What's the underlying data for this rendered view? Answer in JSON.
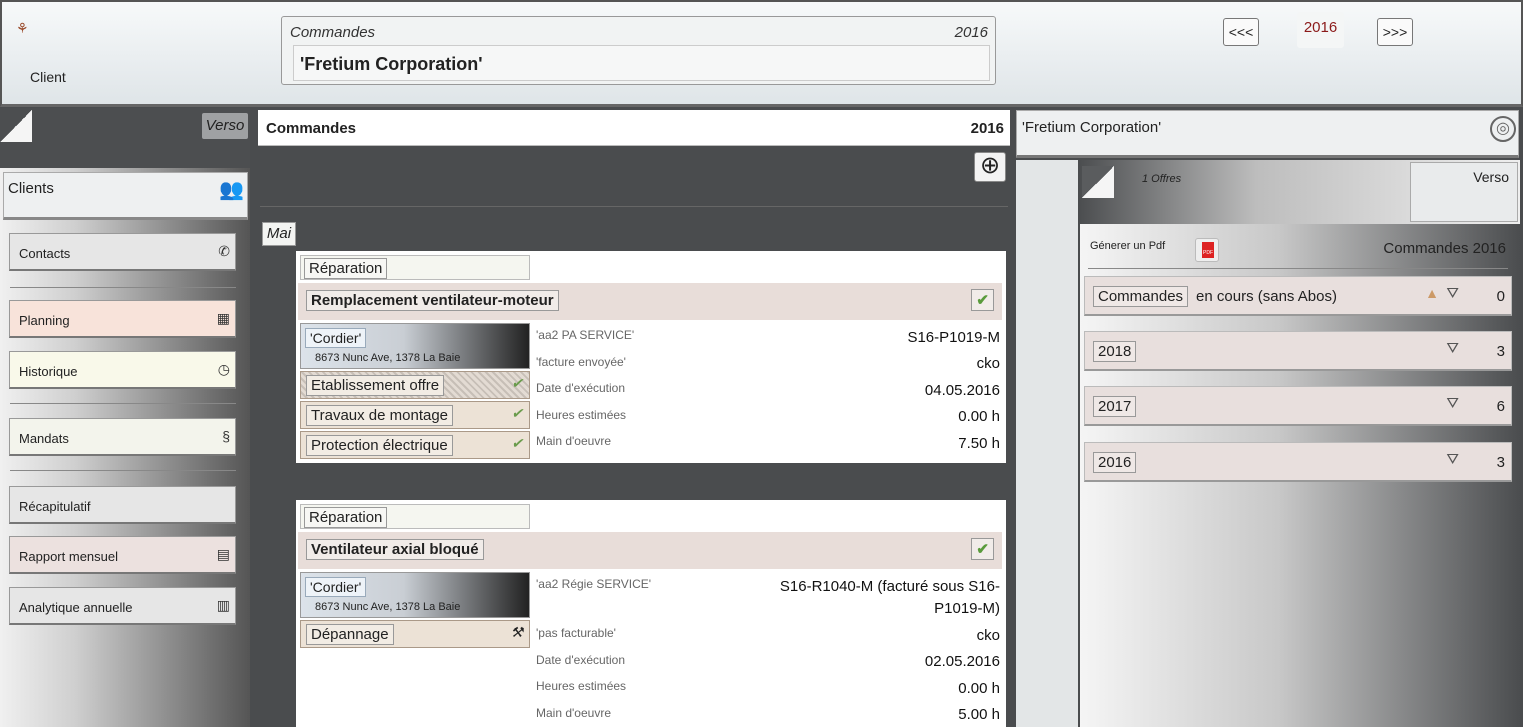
{
  "header": {
    "client_label": "Client",
    "box_label": "Commandes",
    "box_year": "2016",
    "client_name": "'Fretium Corporation'",
    "prev": "<<<",
    "year": "2016",
    "next": ">>>"
  },
  "left": {
    "verso": "Verso",
    "clients": "Clients",
    "items": [
      {
        "label": "Contacts",
        "icon": "phone-icon",
        "bg": "#e6e6e6"
      },
      {
        "label": "Planning",
        "icon": "calendar-icon",
        "bg": "#f8e3da"
      },
      {
        "label": "Historique",
        "icon": "stopwatch-icon",
        "bg": "#f9f9ea"
      },
      {
        "label": "Mandats",
        "icon": "section-icon",
        "bg": "#f3f4ec"
      },
      {
        "label": "Récapitulatif",
        "icon": "",
        "bg": "#e6e6e6"
      },
      {
        "label": "Rapport mensuel",
        "icon": "report-icon",
        "bg": "#ece1df"
      },
      {
        "label": "Analytique annuelle",
        "icon": "chart-icon",
        "bg": "#e6e6e6"
      }
    ]
  },
  "middle": {
    "title": "Commandes",
    "year": "2016",
    "month": "Mai",
    "orders": [
      {
        "type": "Réparation",
        "title": "Remplacement ventilateur-moteur",
        "person": "'Cordier'",
        "address": "8673 Nunc Ave, 1378 La Baie",
        "tasks": [
          "Etablissement offre",
          "Travaux de montage",
          "Protection électrique"
        ],
        "f1l": "'aa2 PA SERVICE'",
        "f1v": "S16-P1019-M",
        "f2l": "'facture envoyée'",
        "f2v": "cko",
        "f3l": "Date d'exécution",
        "f3v": "04.05.2016",
        "f4l": "Heures estimées",
        "f4v": "0.00 h",
        "f5l": "Main d'oeuvre",
        "f5v": "7.50 h"
      },
      {
        "type": "Réparation",
        "title": "Ventilateur axial bloqué",
        "person": "'Cordier'",
        "address": "8673 Nunc Ave, 1378 La Baie",
        "tasks": [
          "Dépannage"
        ],
        "f1l": "'aa2 Régie SERVICE'",
        "f1v": "S16-R1040-M (facturé sous S16-",
        "f1v2": "P1019-M)",
        "f2l": "'pas facturable'",
        "f2v": "cko",
        "f3l": "Date d'exécution",
        "f3v": "02.05.2016",
        "f4l": "Heures estimées",
        "f4v": "0.00 h",
        "f5l": "Main d'oeuvre",
        "f5v": "5.00 h"
      }
    ]
  },
  "right": {
    "client": "'Fretium Corporation'",
    "offres": "1 Offres",
    "verso": "Verso",
    "gen_pdf": "Génerer un Pdf",
    "pdf_icon": "PDF",
    "cmd_title": "Commandes 2016",
    "rows": [
      {
        "label": "Commandes",
        "extra": "en cours (sans Abos)",
        "count": "0"
      },
      {
        "label": "2018",
        "extra": "",
        "count": "3"
      },
      {
        "label": "2017",
        "extra": "",
        "count": "6"
      },
      {
        "label": "2016",
        "extra": "",
        "count": "3"
      }
    ]
  }
}
